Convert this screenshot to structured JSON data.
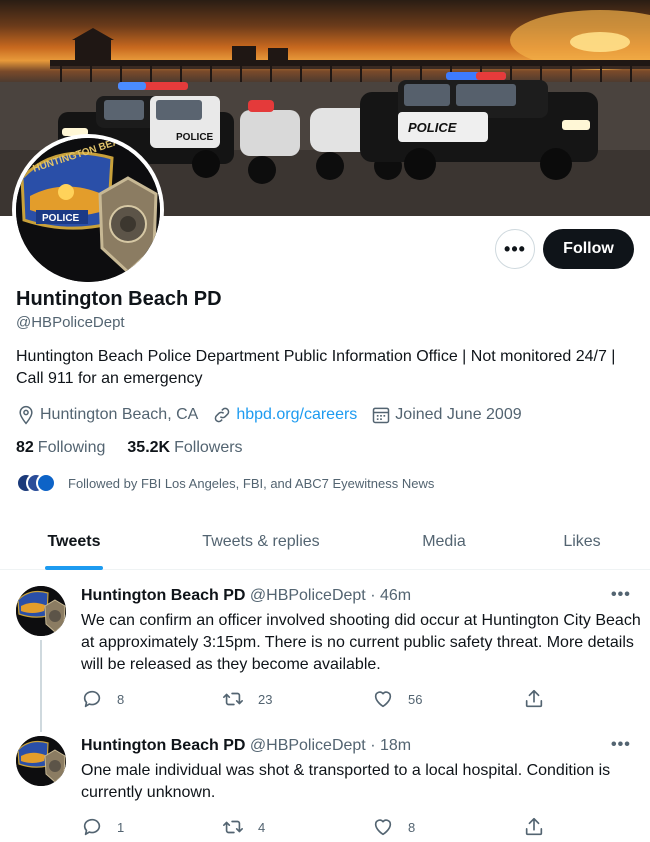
{
  "profile": {
    "name": "Huntington Beach PD",
    "handle": "@HBPoliceDept",
    "bio": "Huntington Beach Police Department Public Information Office | Not monitored 24/7 | Call 911 for an emergency",
    "location": "Huntington Beach, CA",
    "website": "hbpd.org/careers",
    "joined": "Joined June 2009",
    "following_count": "82",
    "following_label": "Following",
    "followers_count": "35.2K",
    "followers_label": "Followers",
    "followed_by": "Followed by FBI Los Angeles, FBI, and ABC7 Eyewitness News",
    "avatar_badge_top": "HUNTINGTON BEACH",
    "avatar_badge_label": "POLICE",
    "banner_car_label": "POLICE"
  },
  "actions": {
    "more_label": "•••",
    "follow_label": "Follow"
  },
  "tabs": [
    {
      "label": "Tweets",
      "active": true
    },
    {
      "label": "Tweets & replies",
      "active": false
    },
    {
      "label": "Media",
      "active": false
    },
    {
      "label": "Likes",
      "active": false
    }
  ],
  "tweets": [
    {
      "name": "Huntington Beach PD",
      "handle": "@HBPoliceDept",
      "time": "· 46m",
      "text": "We can confirm an officer involved shooting did occur at Huntington City Beach at approximately 3:15pm. There is no current public safety threat. More details will be released as they become available.",
      "replies": "8",
      "retweets": "23",
      "likes": "56"
    },
    {
      "name": "Huntington Beach PD",
      "handle": "@HBPoliceDept",
      "time": "· 18m",
      "text": "One male individual was shot & transported to a local hospital. Condition is currently unknown.",
      "replies": "1",
      "retweets": "4",
      "likes": "8"
    }
  ],
  "colors": {
    "accent": "#1d9bf0",
    "text_primary": "#0f1419",
    "text_secondary": "#536471",
    "follow_bg": "#0f1419"
  },
  "icons": [
    "location-icon",
    "link-icon",
    "calendar-icon",
    "reply-icon",
    "retweet-icon",
    "like-icon",
    "share-icon",
    "more-icon"
  ]
}
